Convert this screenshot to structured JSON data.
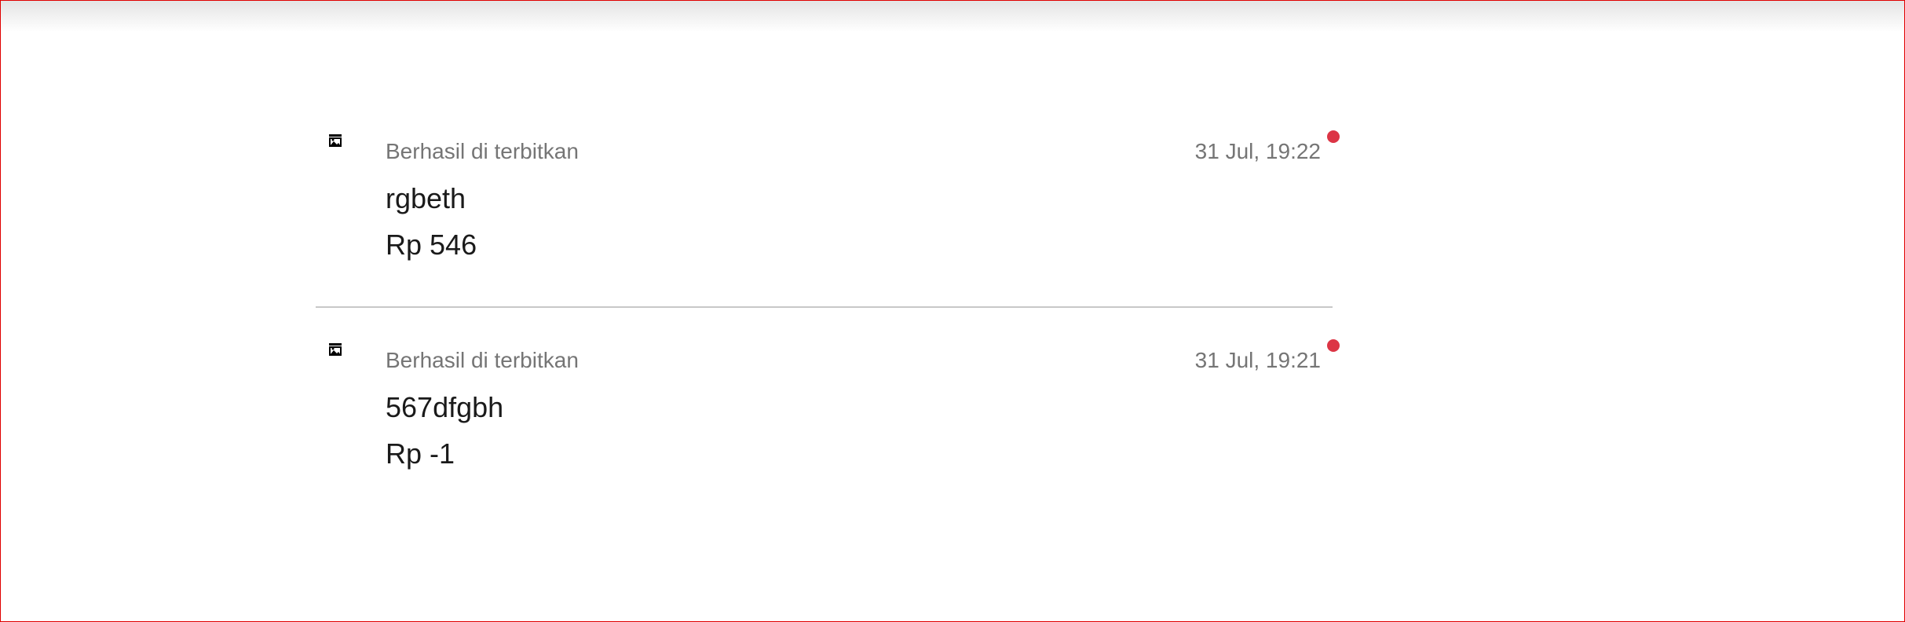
{
  "notifications": [
    {
      "status": "Berhasil di terbitkan",
      "time": "31 Jul, 19:22",
      "title": "rgbeth",
      "price": "Rp 546",
      "icon": "broken-image-icon",
      "unread": true
    },
    {
      "status": "Berhasil di terbitkan",
      "time": "31 Jul, 19:21",
      "title": "567dfgbh",
      "price": "Rp -1",
      "icon": "broken-image-icon",
      "unread": true
    }
  ],
  "colors": {
    "unread_dot": "#dc3545",
    "muted_text": "#757575",
    "border": "#e00000"
  }
}
